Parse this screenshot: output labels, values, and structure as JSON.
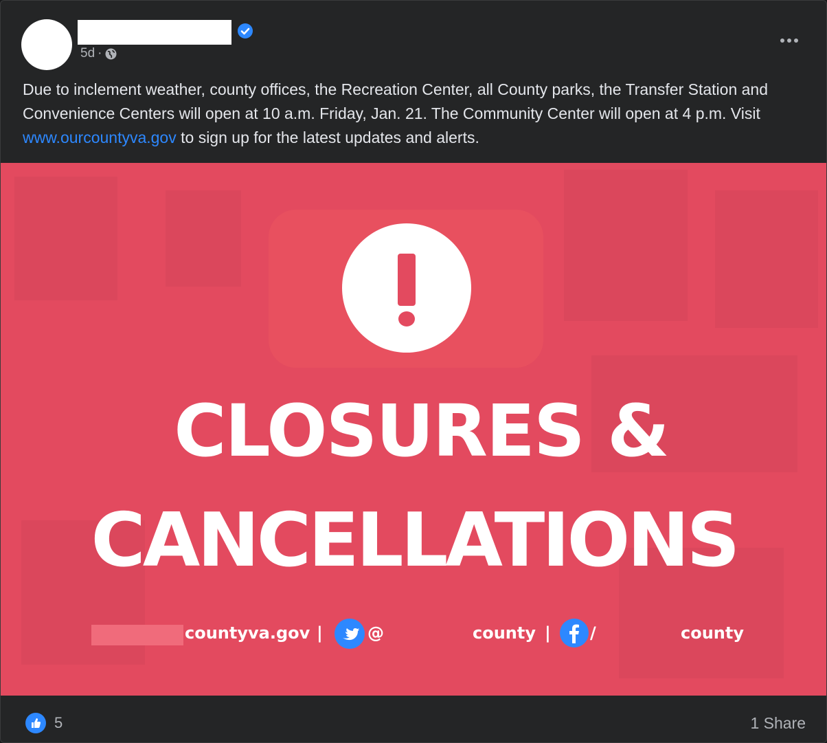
{
  "post": {
    "time": "5d",
    "separator": "·",
    "text_before_link": "Due to inclement weather, county offices, the Recreation Center, all County parks, the Transfer Station and Convenience Centers will open at 10 a.m. Friday, Jan. 21. The Community Center will open at 4 p.m. Visit ",
    "link_text": "www.ourcountyva.gov",
    "text_after_link": " to sign up for the latest updates and alerts."
  },
  "image": {
    "headline_line1": "CLOSURES &",
    "headline_line2": "CANCELLATIONS",
    "footer": {
      "website": "countyva.gov",
      "divider": "|",
      "twitter_prefix": "@",
      "twitter_suffix": "county",
      "facebook_prefix": "/",
      "facebook_suffix": "county"
    }
  },
  "footer": {
    "like_count": "5",
    "share_text": "1 Share"
  },
  "colors": {
    "banner_red": "#e34a5f",
    "link_blue": "#2d88ff",
    "background": "#242526"
  }
}
